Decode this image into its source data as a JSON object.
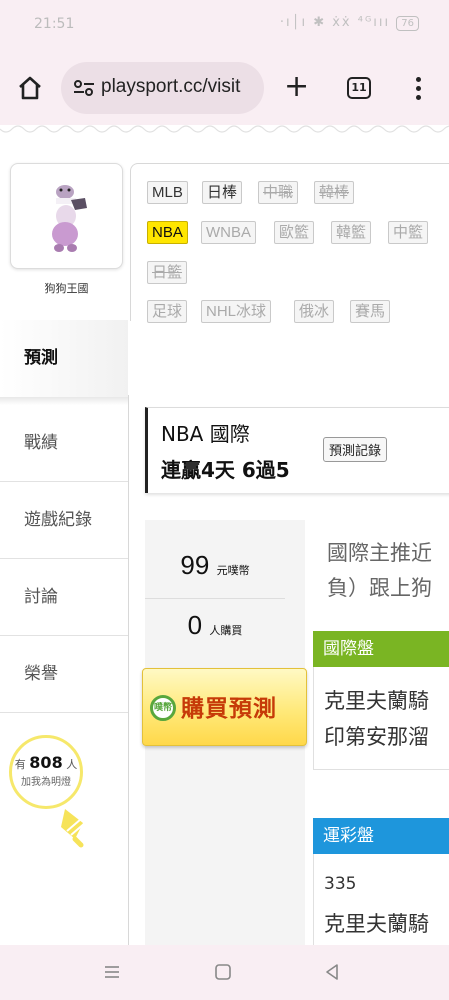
{
  "status_bar": {
    "time": "21:51",
    "icons": "·ı│ı ✱ ẋẋ ⁴ᴳııı",
    "battery": "76"
  },
  "browser": {
    "url": "playsport.cc/visit",
    "tab_count": "11"
  },
  "profile": {
    "name": "狗狗王國"
  },
  "left_nav": {
    "items": [
      {
        "label": "預測",
        "active": true
      },
      {
        "label": "戰績"
      },
      {
        "label": "遊戲紀錄"
      },
      {
        "label": "討論"
      },
      {
        "label": "榮譽"
      }
    ]
  },
  "lamp": {
    "prefix": "有",
    "count": "808",
    "suffix": "人",
    "caption": "加我為明燈"
  },
  "leagues": {
    "row1": [
      "MLB",
      "日棒",
      "中職",
      "韓棒"
    ],
    "row2": [
      "NBA",
      "WNBA",
      "歐籃",
      "韓籃",
      "中籃"
    ],
    "row3": [
      "日籃"
    ],
    "row4": [
      "足球",
      "NHL冰球",
      "俄冰",
      "賽馬"
    ]
  },
  "prediction": {
    "title": "NBA 國際",
    "streak": "連贏4天 6過5",
    "record_button": "預測記錄"
  },
  "stats": {
    "coins_value": "99",
    "coins_unit": "元噗幣",
    "buyers_value": "0",
    "buyers_unit": "人購買",
    "buy_button": "購買預測",
    "buy_icon_text": "噗幣"
  },
  "content": {
    "intro_line1": "國際主推近",
    "intro_line2": "負）跟上狗",
    "intl_header": "國際盤",
    "intl_line1": "克里夫蘭騎",
    "intl_line2": "印第安那溜",
    "lottery_header": "運彩盤",
    "lottery_code": "335",
    "lottery_line1": "克里夫蘭騎"
  }
}
